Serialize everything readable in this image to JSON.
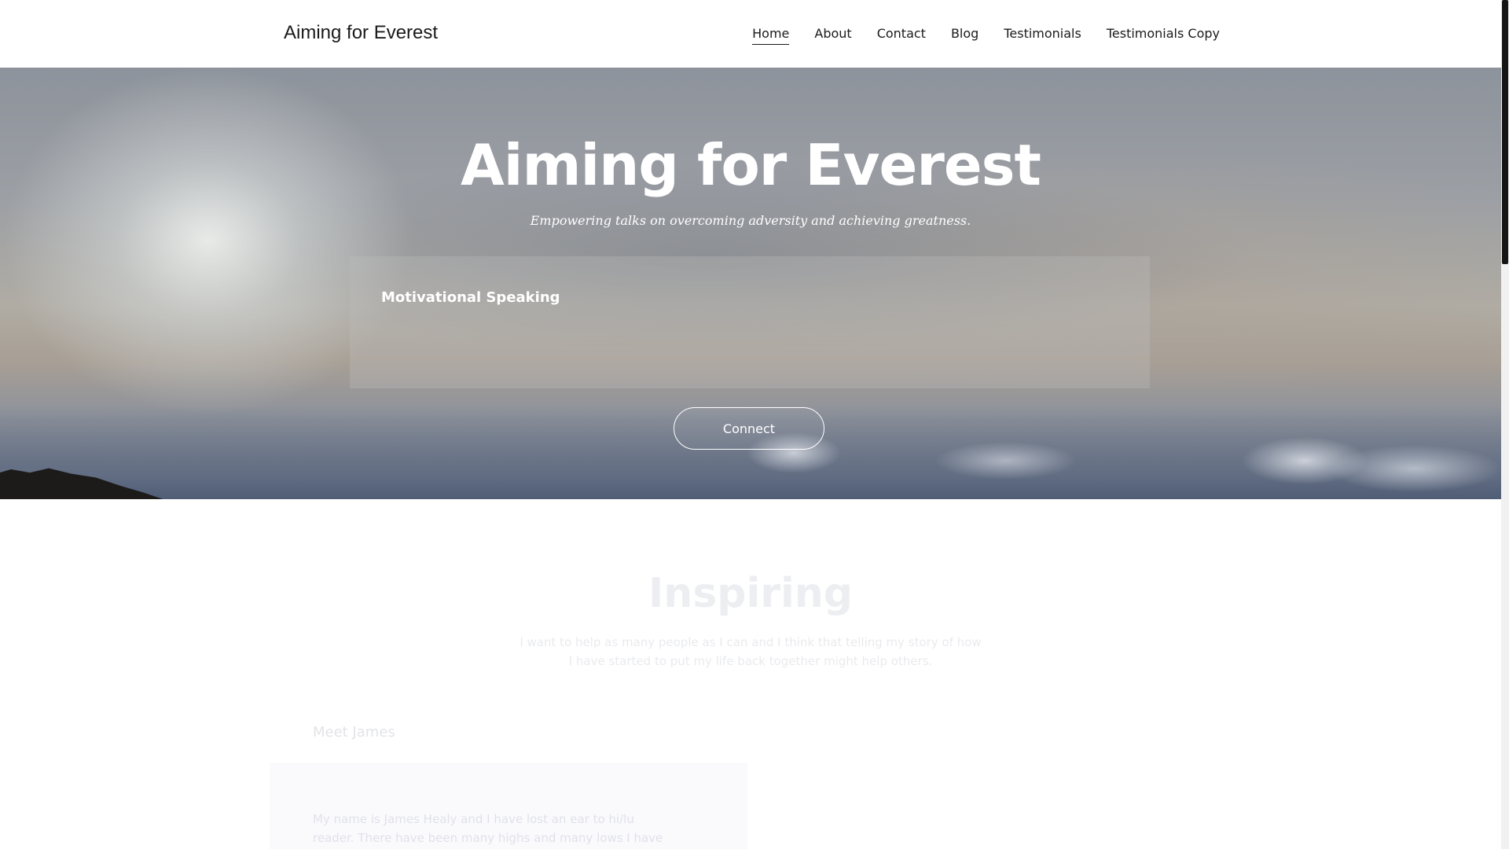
{
  "header": {
    "brand": "Aiming for Everest",
    "nav": [
      "Home",
      "About",
      "Contact",
      "Blog",
      "Testimonials",
      "Testimonials Copy"
    ],
    "active_nav": "Home"
  },
  "hero": {
    "title": "Aiming for Everest",
    "subtitle": "Empowering talks on overcoming adversity and achieving greatness.",
    "card_title": "Motivational Speaking",
    "cta_label": "Connect"
  },
  "section": {
    "title": "Inspiring",
    "text": "I want to help as many people as I can and I think that telling my story of how I have started to put my life back together might help others.",
    "meet_title": "Meet James",
    "meet_text": "My name is James Healy and I have lost an ear to hi/lu reader. There have been many highs and many lows I have faced..."
  },
  "colors": {
    "header_bg": "#ffffff",
    "hero_text": "#ffffff",
    "nav_text": "#1a1a1a"
  }
}
